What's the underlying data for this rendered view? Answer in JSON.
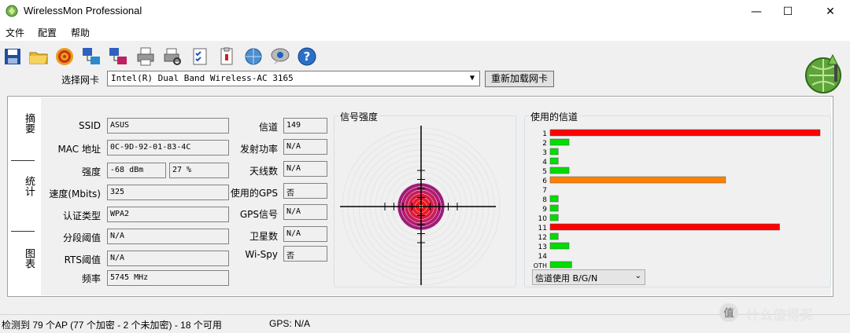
{
  "window": {
    "title": "WirelessMon Professional",
    "minimize": "—",
    "maximize": "☐",
    "close": "✕"
  },
  "menu": [
    "文件",
    "配置",
    "帮助"
  ],
  "toolbar_icons": [
    "save-icon",
    "open-folder-icon",
    "target-icon",
    "network-adapter-icon",
    "network-adapter-alt-icon",
    "printer-icon",
    "print-preview-icon",
    "checklist-icon",
    "clipboard-icon",
    "globe-update-icon",
    "chat-icon",
    "help-icon"
  ],
  "nic": {
    "label": "选择网卡",
    "value": "Intel(R) Dual Band Wireless-AC 3165",
    "reload": "重新加载网卡"
  },
  "tabs": [
    "摘要",
    "统计",
    "图表"
  ],
  "info_left": [
    {
      "label": "SSID",
      "value": "ASUS"
    },
    {
      "label": "MAC 地址",
      "value": "0C-9D-92-01-83-4C"
    },
    {
      "label": "强度",
      "value": "-68 dBm",
      "value2": "27 %"
    },
    {
      "label": "速度(Mbits)",
      "value": "325"
    },
    {
      "label": "认证类型",
      "value": "WPA2"
    },
    {
      "label": "分段阈值",
      "value": "N/A"
    },
    {
      "label": "RTS阈值",
      "value": "N/A"
    },
    {
      "label": "频率",
      "value": "5745 MHz"
    }
  ],
  "info_right": [
    {
      "label": "信道",
      "value": "149"
    },
    {
      "label": "发射功率",
      "value": "N/A"
    },
    {
      "label": "天线数",
      "value": "N/A"
    },
    {
      "label": "使用的GPS",
      "value": "否"
    },
    {
      "label": "GPS信号",
      "value": "N/A"
    },
    {
      "label": "卫星数",
      "value": "N/A"
    },
    {
      "label": "Wi-Spy",
      "value": "否"
    }
  ],
  "signal_group": {
    "title": "信号强度",
    "strength_percent": 27
  },
  "channel_group": {
    "title": "使用的信道",
    "select_value": "信道使用 B/G/N"
  },
  "chart_data": {
    "type": "bar",
    "orientation": "horizontal",
    "categories": [
      "1",
      "2",
      "3",
      "4",
      "5",
      "6",
      "7",
      "8",
      "9",
      "10",
      "11",
      "12",
      "13",
      "14",
      "OTH"
    ],
    "values": [
      100,
      7,
      3,
      3,
      7,
      65,
      0,
      3,
      3,
      3,
      85,
      3,
      7,
      0,
      8
    ],
    "colors": [
      "#ff0000",
      "#00dd00",
      "#00dd00",
      "#00dd00",
      "#00dd00",
      "#ff8000",
      "#00dd00",
      "#00dd00",
      "#00dd00",
      "#00dd00",
      "#ff0000",
      "#00dd00",
      "#00dd00",
      "#00dd00",
      "#00dd00"
    ]
  },
  "status": {
    "ap_summary": "检测到 79 个AP (77 个加密 - 2 个未加密) - 18 个可用",
    "gps": "GPS: N/A"
  },
  "watermark": "值 什么值得买"
}
